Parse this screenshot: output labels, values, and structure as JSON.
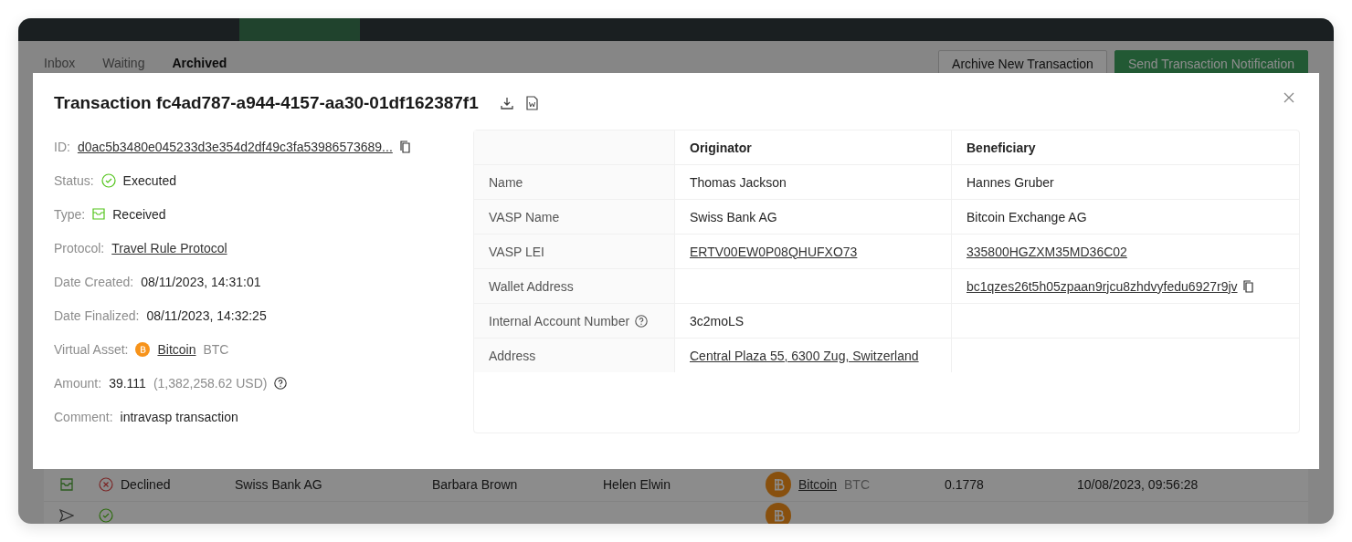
{
  "background": {
    "tabs": [
      {
        "label": "Inbox",
        "selected": false
      },
      {
        "label": "Waiting",
        "selected": false
      },
      {
        "label": "Archived",
        "selected": true
      }
    ],
    "buttons": [
      {
        "label": "Archive New Transaction",
        "kind": "secondary"
      },
      {
        "label": "Send Transaction Notification",
        "kind": "primary"
      }
    ],
    "rows": [
      {
        "type": {
          "kind": "received"
        },
        "status": {
          "label": "Declined",
          "kind": "declined"
        },
        "vasp": "Swiss Bank AG",
        "originator": "Barbara Brown",
        "beneficiary": "Helen Elwin",
        "asset": "Bitcoin",
        "asset_code": "BTC",
        "amount": "0.1778",
        "date": "10/08/2023, 09:56:28"
      }
    ]
  },
  "modal": {
    "title": "Transaction fc4ad787-a944-4157-aa30-01df162387f1",
    "fields": [
      {
        "label": "ID:",
        "kind": "link",
        "value": "d0ac5b3480e045233d3e354d2df49c3fa53986573689...",
        "copy": true
      },
      {
        "label": "Status:",
        "kind": "executed",
        "value": "Executed"
      },
      {
        "label": "Type:",
        "kind": "received",
        "value": "Received"
      },
      {
        "label": "Protocol:",
        "kind": "link",
        "value": "Travel Rule Protocol",
        "copy": false
      },
      {
        "label": "Date Created:",
        "kind": "text",
        "value": "08/11/2023, 14:31:01"
      },
      {
        "label": "Date Finalized:",
        "kind": "text",
        "value": "08/11/2023, 14:32:25"
      },
      {
        "label": "Virtual Asset:",
        "kind": "asset",
        "value": "Bitcoin",
        "code": "BTC"
      },
      {
        "label": "Amount:",
        "kind": "amount",
        "value": "39.111",
        "converted": "(1,382,258.62 USD)"
      },
      {
        "label": "Comment:",
        "kind": "text",
        "value": "intravasp transaction"
      }
    ],
    "table": {
      "columns": [
        "Originator",
        "Beneficiary"
      ],
      "rows": [
        {
          "label": "Name",
          "help": false,
          "cells": [
            {
              "text": "Thomas Jackson",
              "link": false,
              "copy": false
            },
            {
              "text": "Hannes Gruber",
              "link": false,
              "copy": false
            }
          ]
        },
        {
          "label": "VASP Name",
          "help": false,
          "cells": [
            {
              "text": "Swiss Bank AG",
              "link": false,
              "copy": false
            },
            {
              "text": "Bitcoin Exchange AG",
              "link": false,
              "copy": false
            }
          ]
        },
        {
          "label": "VASP LEI",
          "help": false,
          "cells": [
            {
              "text": "ERTV00EW0P08QHUFXO73",
              "link": true,
              "copy": false
            },
            {
              "text": "335800HGZXM35MD36C02",
              "link": true,
              "copy": false
            }
          ]
        },
        {
          "label": "Wallet Address",
          "help": false,
          "cells": [
            null,
            {
              "text": "bc1qzes26t5h05zpaan9rjcu8zhdvyfedu6927r9jv",
              "link": true,
              "copy": true
            }
          ]
        },
        {
          "label": "Internal Account Number",
          "help": true,
          "cells": [
            {
              "text": "3c2moLS",
              "link": false,
              "copy": false
            },
            null
          ]
        },
        {
          "label": "Address",
          "help": false,
          "cells": [
            {
              "text": "Central Plaza 55, 6300 Zug, Switzerland",
              "link": true,
              "copy": false
            },
            null
          ]
        }
      ]
    }
  }
}
